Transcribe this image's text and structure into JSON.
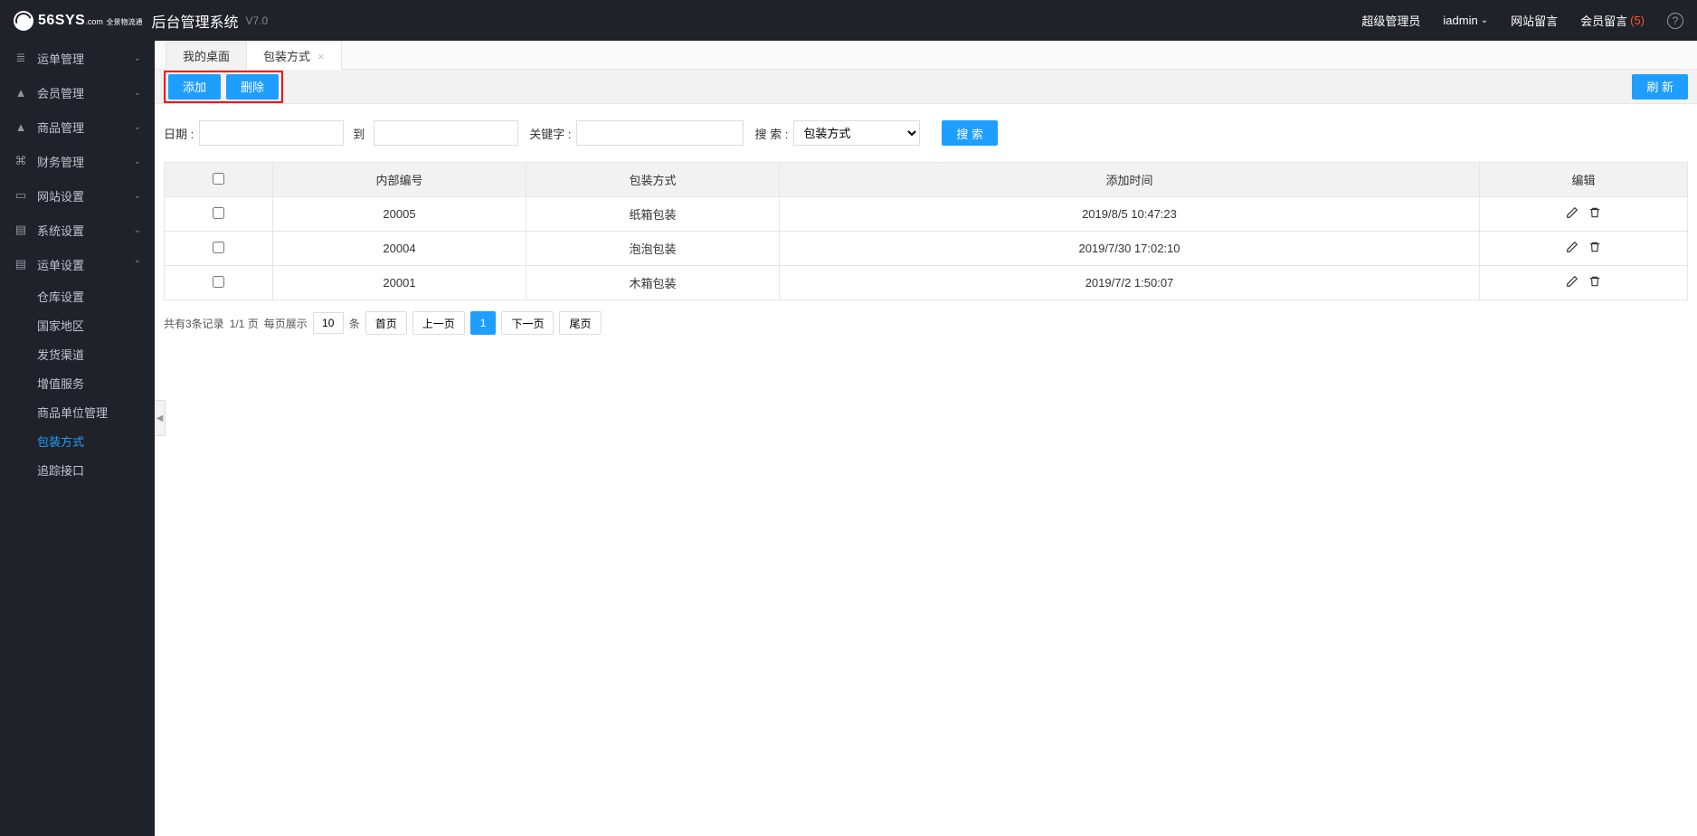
{
  "header": {
    "logo_main": "56SYS",
    "logo_sub": ".com",
    "logo_tag": "全景物流通",
    "title": "后台管理系统",
    "version": "V7.0",
    "role": "超级管理员",
    "user": "iadmin",
    "nav_site_message": "网站留言",
    "nav_member_message": "会员留言",
    "member_message_count": "(5)"
  },
  "sidebar": {
    "items": [
      {
        "icon": "≣",
        "label": "运单管理"
      },
      {
        "icon": "▲",
        "label": "会员管理"
      },
      {
        "icon": "▲",
        "label": "商品管理"
      },
      {
        "icon": "⌘",
        "label": "财务管理"
      },
      {
        "icon": "▭",
        "label": "网站设置"
      },
      {
        "icon": "▤",
        "label": "系统设置"
      },
      {
        "icon": "▤",
        "label": "运单设置",
        "open": true
      }
    ],
    "sub": [
      {
        "label": "仓库设置"
      },
      {
        "label": "国家地区"
      },
      {
        "label": "发货渠道"
      },
      {
        "label": "增值服务"
      },
      {
        "label": "商品单位管理"
      },
      {
        "label": "包装方式",
        "active": true
      },
      {
        "label": "追踪接口"
      }
    ]
  },
  "tabs": [
    {
      "label": "我的桌面",
      "closable": false,
      "active": true
    },
    {
      "label": "包装方式",
      "closable": true,
      "active": false
    }
  ],
  "toolbar": {
    "add": "添加",
    "delete": "删除",
    "refresh": "刷 新"
  },
  "filter": {
    "date_label": "日期 :",
    "to": "到",
    "keyword_label": "关键字 :",
    "search_label": "搜 索 :",
    "select_value": "包装方式",
    "search_btn": "搜 索"
  },
  "table": {
    "headers": {
      "id": "内部编号",
      "type": "包装方式",
      "time": "添加时间",
      "edit": "编辑"
    },
    "rows": [
      {
        "id": "20005",
        "type": "纸箱包装",
        "time": "2019/8/5 10:47:23",
        "highlight": true
      },
      {
        "id": "20004",
        "type": "泡泡包装",
        "time": "2019/7/30 17:02:10"
      },
      {
        "id": "20001",
        "type": "木箱包装",
        "time": "2019/7/2 1:50:07"
      }
    ]
  },
  "pagination": {
    "summary": "共有3条记录",
    "pageinfo": "1/1 页",
    "per_page_label": "每页展示",
    "per_page_value": "10",
    "unit": "条",
    "first": "首页",
    "prev": "上一页",
    "current": "1",
    "next": "下一页",
    "last": "尾页"
  }
}
